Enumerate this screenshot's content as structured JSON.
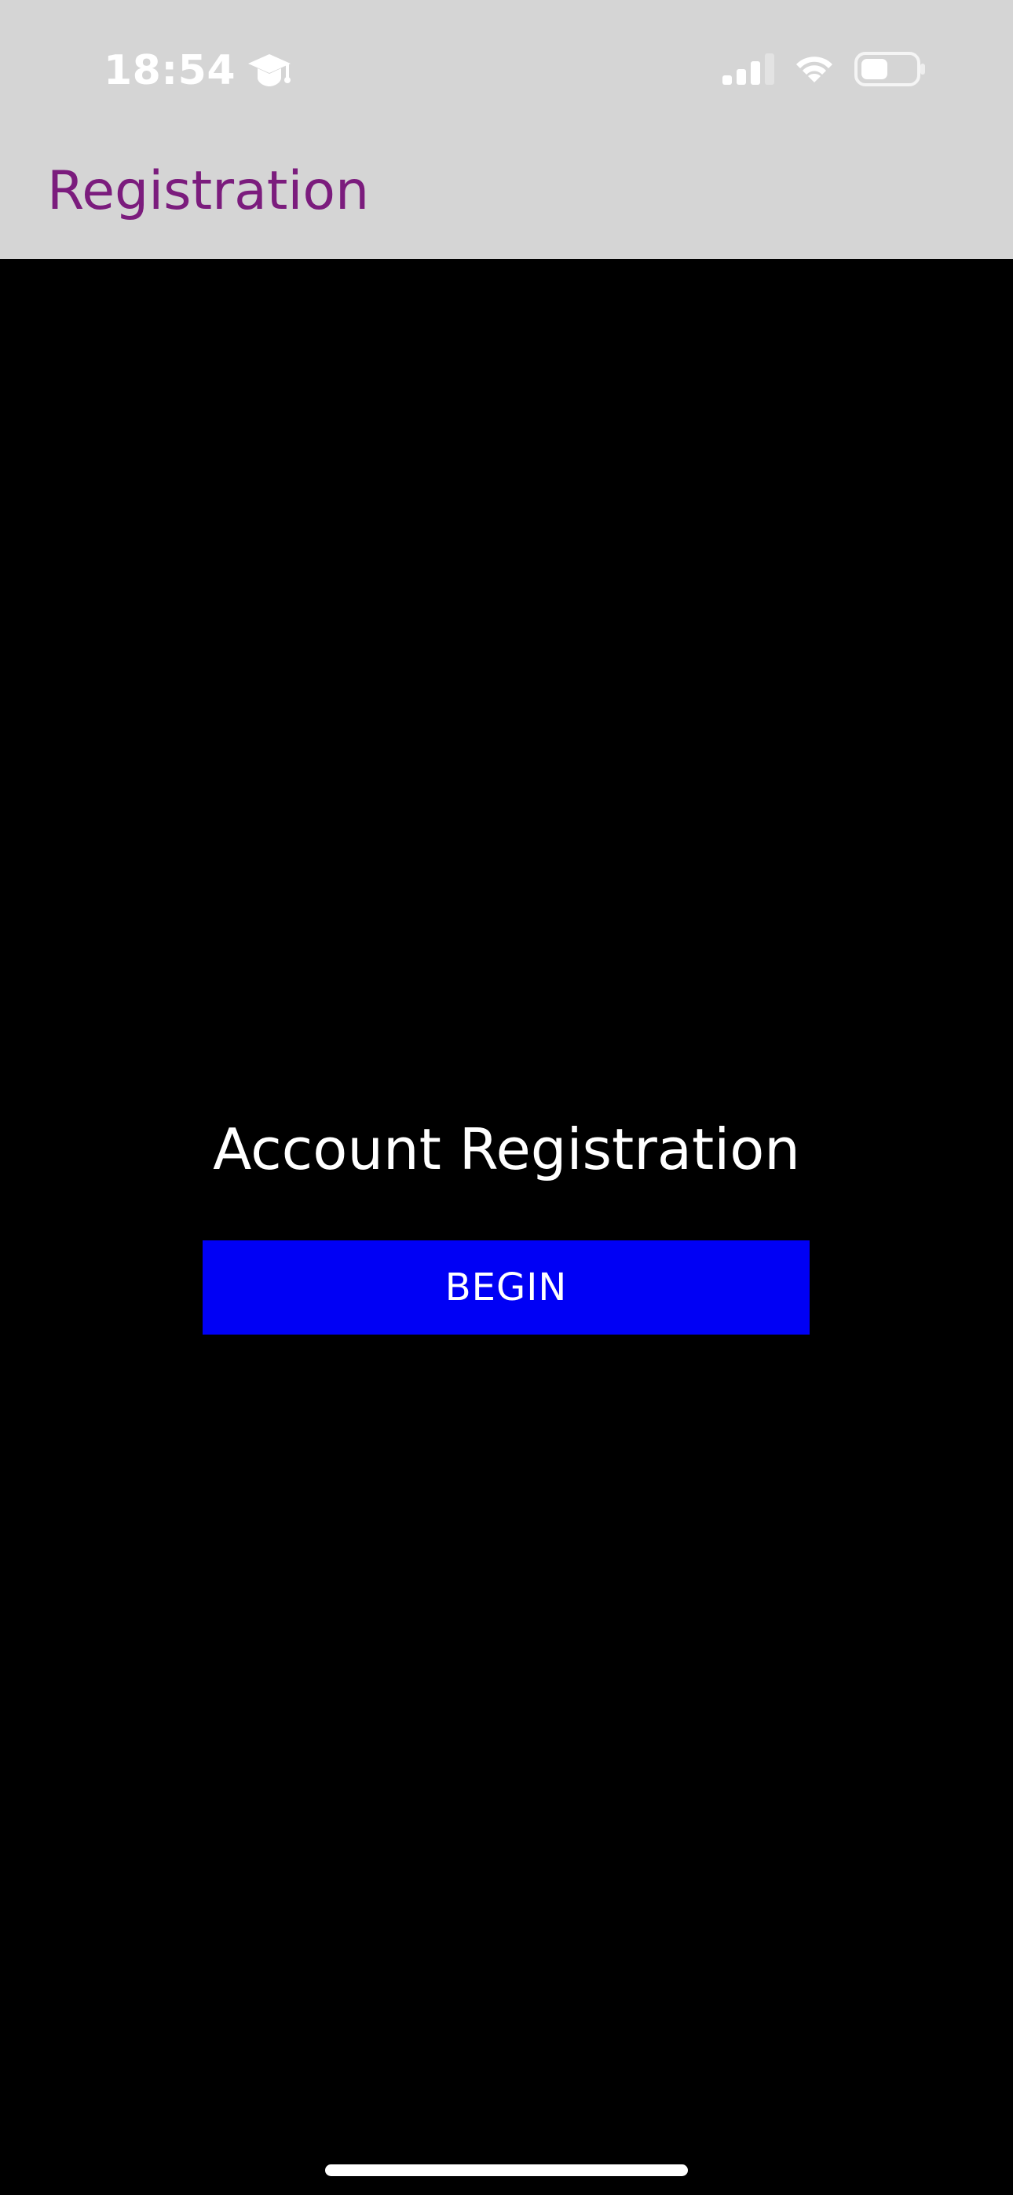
{
  "status_bar": {
    "time": "18:54",
    "icons": {
      "education": "graduation-cap-icon",
      "signal": "cellular-signal-icon",
      "wifi": "wifi-icon",
      "battery": "battery-icon"
    },
    "cellular_bars_filled": 3,
    "battery_level": 0.45
  },
  "nav": {
    "title": "Registration"
  },
  "main": {
    "headline": "Account Registration",
    "begin_label": "BEGIN"
  },
  "colors": {
    "header_background": "#d5d5d5",
    "nav_title": "#7b1c7d",
    "content_background": "#000000",
    "button_background": "#0000f5",
    "text": "#ffffff"
  }
}
